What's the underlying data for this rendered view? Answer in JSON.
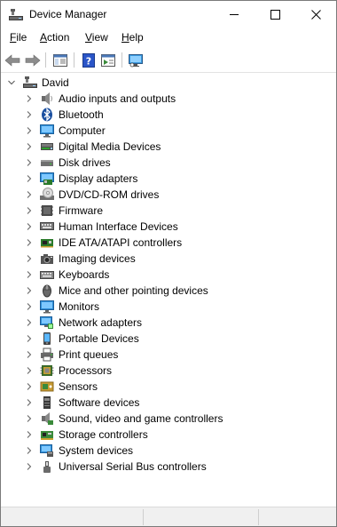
{
  "window": {
    "title": "Device Manager"
  },
  "menu": {
    "file": {
      "key": "F",
      "rest": "ile"
    },
    "action": {
      "key": "A",
      "rest": "ction"
    },
    "view": {
      "key": "V",
      "rest": "iew"
    },
    "help": {
      "key": "H",
      "rest": "elp"
    }
  },
  "toolbar": {
    "icons": [
      "back-arrow-icon",
      "forward-arrow-icon",
      "show-hide-console-tree-icon",
      "help-icon",
      "action-pane-icon",
      "scan-hardware-icon"
    ]
  },
  "tree": {
    "root": {
      "label": "David",
      "icon": "computer-icon"
    },
    "categories": [
      {
        "label": "Audio inputs and outputs",
        "icon": "speaker-icon"
      },
      {
        "label": "Bluetooth",
        "icon": "bluetooth-icon"
      },
      {
        "label": "Computer",
        "icon": "computer-icon"
      },
      {
        "label": "Digital Media Devices",
        "icon": "media-device-icon"
      },
      {
        "label": "Disk drives",
        "icon": "disk-drive-icon"
      },
      {
        "label": "Display adapters",
        "icon": "display-adapter-icon"
      },
      {
        "label": "DVD/CD-ROM drives",
        "icon": "dvd-drive-icon"
      },
      {
        "label": "Firmware",
        "icon": "firmware-icon"
      },
      {
        "label": "Human Interface Devices",
        "icon": "hid-icon"
      },
      {
        "label": "IDE ATA/ATAPI controllers",
        "icon": "ide-controller-icon"
      },
      {
        "label": "Imaging devices",
        "icon": "camera-icon"
      },
      {
        "label": "Keyboards",
        "icon": "keyboard-icon"
      },
      {
        "label": "Mice and other pointing devices",
        "icon": "mouse-icon"
      },
      {
        "label": "Monitors",
        "icon": "monitor-icon"
      },
      {
        "label": "Network adapters",
        "icon": "network-adapter-icon"
      },
      {
        "label": "Portable Devices",
        "icon": "portable-device-icon"
      },
      {
        "label": "Print queues",
        "icon": "printer-icon"
      },
      {
        "label": "Processors",
        "icon": "processor-icon"
      },
      {
        "label": "Sensors",
        "icon": "sensor-icon"
      },
      {
        "label": "Software devices",
        "icon": "software-device-icon"
      },
      {
        "label": "Sound, video and game controllers",
        "icon": "sound-controller-icon"
      },
      {
        "label": "Storage controllers",
        "icon": "storage-controller-icon"
      },
      {
        "label": "System devices",
        "icon": "system-device-icon"
      },
      {
        "label": "Universal Serial Bus controllers",
        "icon": "usb-icon"
      }
    ]
  },
  "colors": {
    "accent": "#0078d7",
    "chevron": "#606060"
  }
}
